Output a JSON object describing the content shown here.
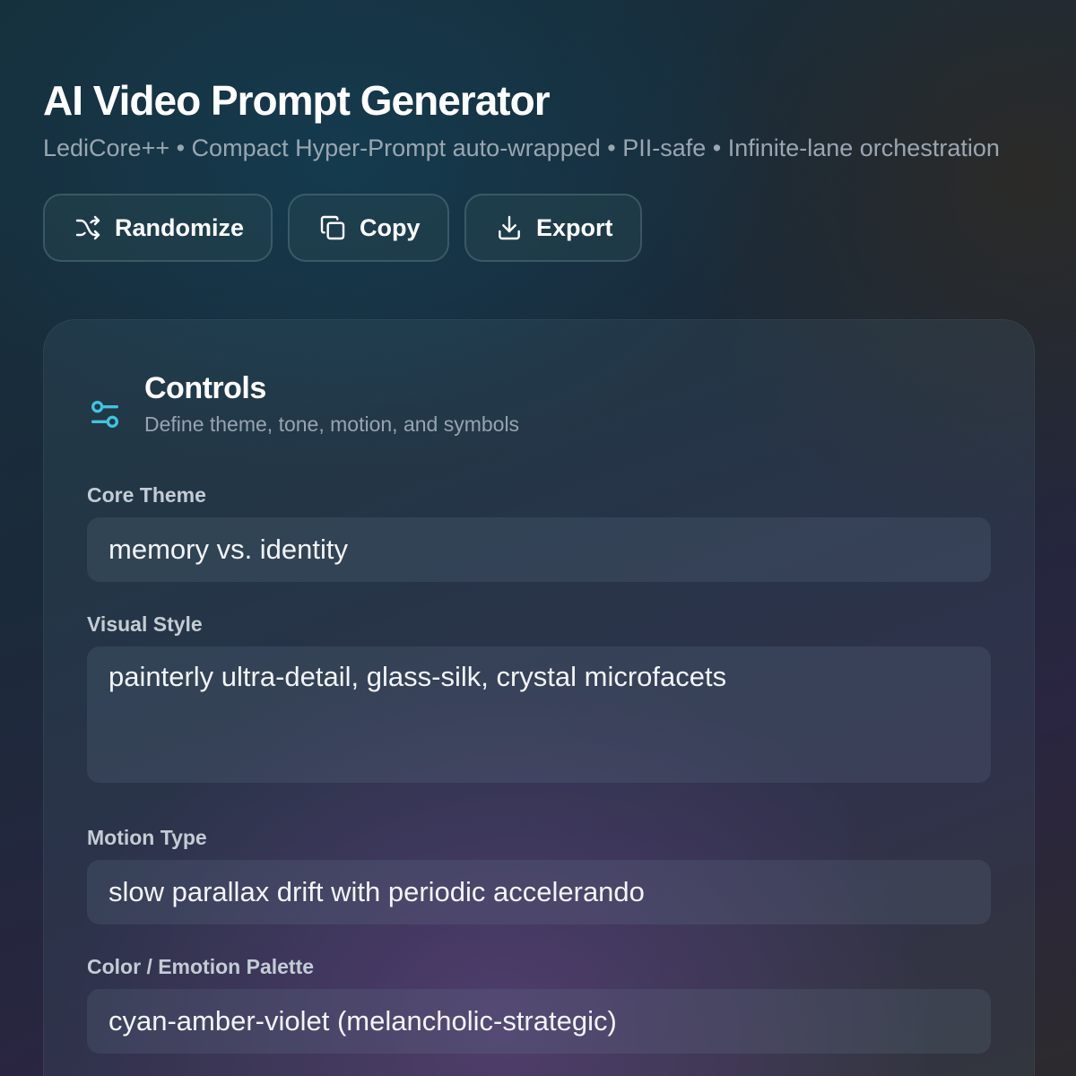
{
  "header": {
    "title": "AI Video Prompt Generator",
    "subtitle": "LediCore++ • Compact Hyper-Prompt auto-wrapped • PII-safe • Infinite-lane orchestration"
  },
  "toolbar": {
    "randomize_label": "Randomize",
    "randomize_icon": "shuffle-icon",
    "copy_label": "Copy",
    "copy_icon": "copy-icon",
    "export_label": "Export",
    "export_icon": "download-icon"
  },
  "controls": {
    "icon": "sliders-icon",
    "accent_color": "#3fc4e0",
    "title": "Controls",
    "description": "Define theme, tone, motion, and symbols",
    "fields": [
      {
        "label": "Core Theme",
        "value": "memory vs. identity"
      },
      {
        "label": "Visual Style",
        "value": "painterly ultra-detail, glass-silk, crystal microfacets"
      },
      {
        "label": "Motion Type",
        "value": "slow parallax drift with periodic accelerando"
      },
      {
        "label": "Color / Emotion Palette",
        "value": "cyan-amber-violet (melancholic-strategic)"
      }
    ]
  }
}
